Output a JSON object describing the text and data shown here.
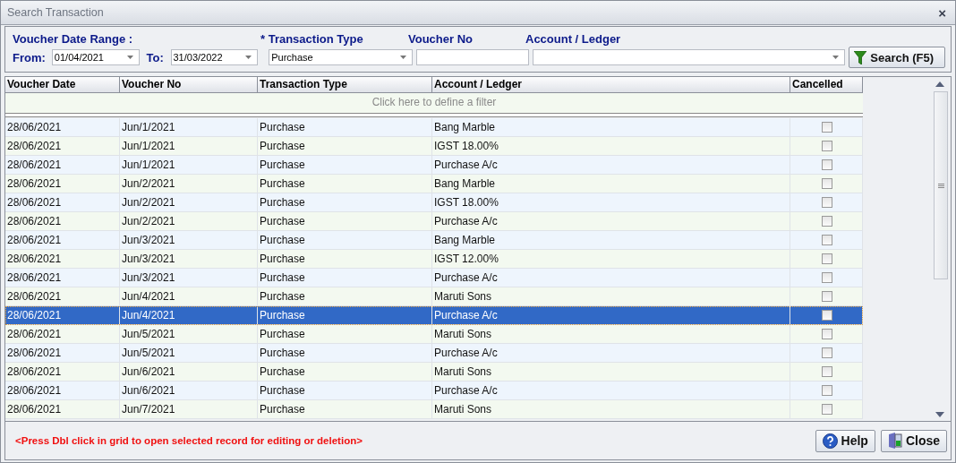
{
  "window": {
    "title": "Search Transaction",
    "close": "×"
  },
  "filters": {
    "date_range_label": "Voucher Date Range :",
    "from": {
      "label": "From:",
      "value": "01/04/2021"
    },
    "to": {
      "label": "To:",
      "value": "31/03/2022"
    },
    "transaction_type": {
      "label": "* Transaction Type",
      "value": "Purchase"
    },
    "voucher_no": {
      "label": "Voucher No"
    },
    "account_ledger": {
      "label": "Account / Ledger"
    },
    "search_button": "Search (F5)"
  },
  "table": {
    "columns": [
      "Voucher Date",
      "Voucher No",
      "Transaction Type",
      "Account / Ledger",
      "Cancelled"
    ],
    "filter_row": "Click here to define a filter",
    "rows": [
      {
        "date": "28/06/2021",
        "voucher_no": "Jun/1/2021",
        "type": "Purchase",
        "account": "Bang Marble",
        "cancelled": false,
        "selected": false
      },
      {
        "date": "28/06/2021",
        "voucher_no": "Jun/1/2021",
        "type": "Purchase",
        "account": "IGST 18.00%",
        "cancelled": false,
        "selected": false
      },
      {
        "date": "28/06/2021",
        "voucher_no": "Jun/1/2021",
        "type": "Purchase",
        "account": "Purchase A/c",
        "cancelled": false,
        "selected": false
      },
      {
        "date": "28/06/2021",
        "voucher_no": "Jun/2/2021",
        "type": "Purchase",
        "account": "Bang Marble",
        "cancelled": false,
        "selected": false
      },
      {
        "date": "28/06/2021",
        "voucher_no": "Jun/2/2021",
        "type": "Purchase",
        "account": "IGST 18.00%",
        "cancelled": false,
        "selected": false
      },
      {
        "date": "28/06/2021",
        "voucher_no": "Jun/2/2021",
        "type": "Purchase",
        "account": "Purchase A/c",
        "cancelled": false,
        "selected": false
      },
      {
        "date": "28/06/2021",
        "voucher_no": "Jun/3/2021",
        "type": "Purchase",
        "account": "Bang Marble",
        "cancelled": false,
        "selected": false
      },
      {
        "date": "28/06/2021",
        "voucher_no": "Jun/3/2021",
        "type": "Purchase",
        "account": "IGST 12.00%",
        "cancelled": false,
        "selected": false
      },
      {
        "date": "28/06/2021",
        "voucher_no": "Jun/3/2021",
        "type": "Purchase",
        "account": "Purchase A/c",
        "cancelled": false,
        "selected": false
      },
      {
        "date": "28/06/2021",
        "voucher_no": "Jun/4/2021",
        "type": "Purchase",
        "account": "Maruti Sons",
        "cancelled": false,
        "selected": false
      },
      {
        "date": "28/06/2021",
        "voucher_no": "Jun/4/2021",
        "type": "Purchase",
        "account": "Purchase A/c",
        "cancelled": false,
        "selected": true
      },
      {
        "date": "28/06/2021",
        "voucher_no": "Jun/5/2021",
        "type": "Purchase",
        "account": "Maruti Sons",
        "cancelled": false,
        "selected": false
      },
      {
        "date": "28/06/2021",
        "voucher_no": "Jun/5/2021",
        "type": "Purchase",
        "account": "Purchase A/c",
        "cancelled": false,
        "selected": false
      },
      {
        "date": "28/06/2021",
        "voucher_no": "Jun/6/2021",
        "type": "Purchase",
        "account": "Maruti Sons",
        "cancelled": false,
        "selected": false
      },
      {
        "date": "28/06/2021",
        "voucher_no": "Jun/6/2021",
        "type": "Purchase",
        "account": "Purchase A/c",
        "cancelled": false,
        "selected": false
      },
      {
        "date": "28/06/2021",
        "voucher_no": "Jun/7/2021",
        "type": "Purchase",
        "account": "Maruti Sons",
        "cancelled": false,
        "selected": false
      }
    ]
  },
  "footer": {
    "hint": "<Press Dbl click in grid to open selected record for editing or deletion>",
    "buttons": [
      {
        "kind": "help",
        "label": "Help"
      },
      {
        "kind": "close",
        "label": "Close"
      }
    ]
  }
}
